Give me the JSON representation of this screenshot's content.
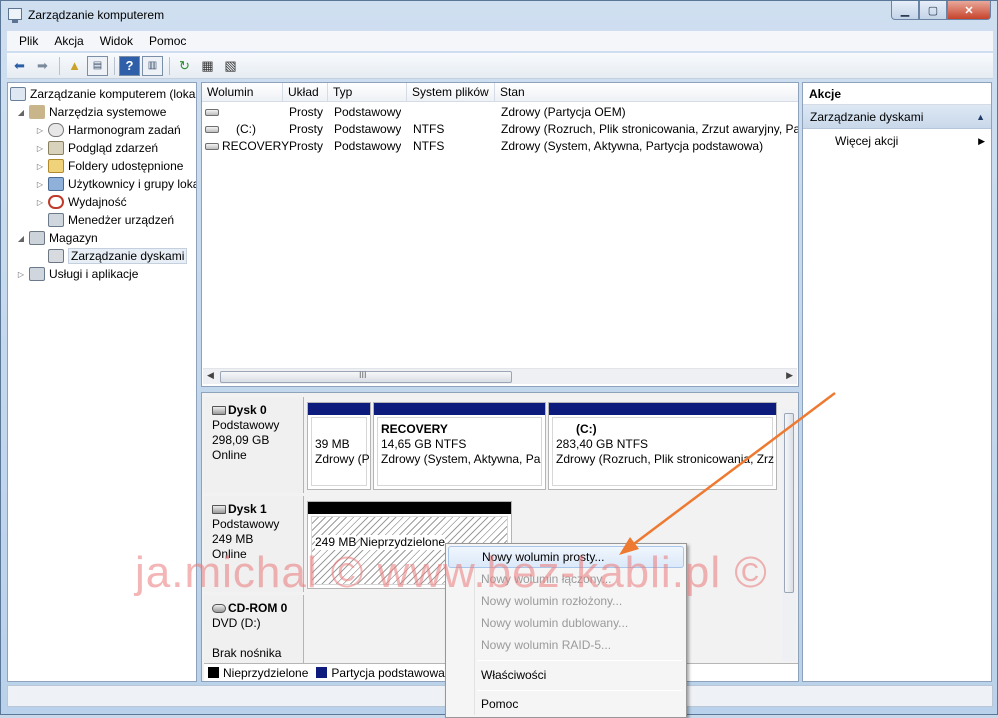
{
  "window": {
    "title": "Zarządzanie komputerem"
  },
  "menu": [
    "Plik",
    "Akcja",
    "Widok",
    "Pomoc"
  ],
  "tree": {
    "root": "Zarządzanie komputerem (lokalny)",
    "system_tools": "Narzędzia systemowe",
    "task_scheduler": "Harmonogram zadań",
    "event_viewer": "Podgląd zdarzeń",
    "shared_folders": "Foldery udostępnione",
    "users_groups": "Użytkownicy i grupy lokalne",
    "performance": "Wydajność",
    "device_manager": "Menedżer urządzeń",
    "storage": "Magazyn",
    "disk_management": "Zarządzanie dyskami",
    "services": "Usługi i aplikacje"
  },
  "volumes": {
    "columns": [
      "Wolumin",
      "Układ",
      "Typ",
      "System plików",
      "Stan"
    ],
    "rows": [
      {
        "name": "",
        "layout": "Prosty",
        "type": "Podstawowy",
        "fs": "",
        "status": "Zdrowy (Partycja OEM)"
      },
      {
        "name": "(C:)",
        "layout": "Prosty",
        "type": "Podstawowy",
        "fs": "NTFS",
        "status": "Zdrowy (Rozruch, Plik stronicowania, Zrzut awaryjny, Pa"
      },
      {
        "name": "RECOVERY",
        "layout": "Prosty",
        "type": "Podstawowy",
        "fs": "NTFS",
        "status": "Zdrowy (System, Aktywna, Partycja podstawowa)"
      }
    ],
    "scroll_grip": "III"
  },
  "disks": [
    {
      "name": "Dysk 0",
      "kind": "Podstawowy",
      "size": "298,09 GB",
      "state": "Online",
      "partitions": [
        {
          "title": "",
          "size": "39 MB",
          "status": "Zdrowy (P"
        },
        {
          "title": "RECOVERY",
          "size": "14,65 GB NTFS",
          "status": "Zdrowy (System, Aktywna, Pa"
        },
        {
          "title": "(C:)",
          "size": "283,40 GB NTFS",
          "status": "Zdrowy (Rozruch, Plik stronicowania, Zrz"
        }
      ]
    },
    {
      "name": "Dysk 1",
      "kind": "Podstawowy",
      "size": "249 MB",
      "state": "Online",
      "partitions": [
        {
          "size": "249 MB",
          "status": "Nieprzydzielone"
        }
      ]
    },
    {
      "name": "CD-ROM 0",
      "kind": "DVD (D:)",
      "media": "Brak nośnika"
    }
  ],
  "legend": [
    {
      "label": "Nieprzydzielone",
      "color": "#000000"
    },
    {
      "label": "Partycja podstawowa",
      "color": "#0d1b7d"
    }
  ],
  "actions": {
    "header": "Akcje",
    "section": "Zarządzanie dyskami",
    "more": "Więcej akcji"
  },
  "context_menu": {
    "new_simple": "Nowy wolumin prosty...",
    "new_spanned": "Nowy wolumin łączony...",
    "new_striped": "Nowy wolumin rozłożony...",
    "new_mirrored": "Nowy wolumin dublowany...",
    "new_raid5": "Nowy wolumin RAID-5...",
    "properties": "Właściwości",
    "help": "Pomoc"
  },
  "watermark": "ja.michal © www.bez-kabli.pl ©",
  "colors": {
    "accent_arrow": "#ee7a32",
    "primary_partition": "#0d1b7d",
    "unallocated": "#000000"
  }
}
